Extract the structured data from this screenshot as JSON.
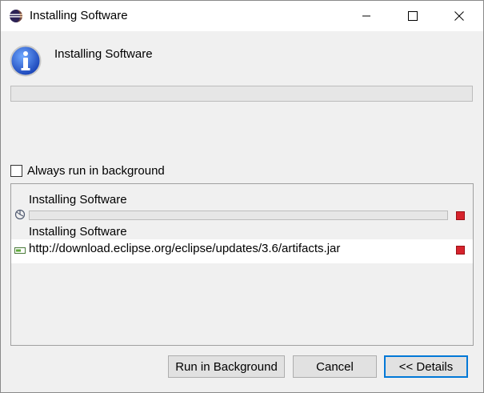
{
  "window": {
    "title": "Installing Software",
    "controls": {
      "minimize": "minimize-icon",
      "maximize": "maximize-icon",
      "close": "close-icon"
    }
  },
  "header": {
    "icon": "info-icon",
    "title": "Installing Software",
    "progress": 0
  },
  "options": {
    "always_run_in_background_label": "Always run in background",
    "always_run_in_background_checked": false
  },
  "jobs": [
    {
      "title": "Installing Software",
      "icon": "progress-spinner-icon",
      "progress": 0,
      "subtask": "Installing Software"
    },
    {
      "icon": "download-task-icon",
      "url": "http://download.eclipse.org/eclipse/updates/3.6/artifacts.jar"
    }
  ],
  "buttons": {
    "run_in_background": "Run in Background",
    "cancel": "Cancel",
    "details": "<< Details"
  },
  "colors": {
    "accent": "#0078d7",
    "stop": "#d6232c",
    "panel": "#f0f0f0"
  }
}
